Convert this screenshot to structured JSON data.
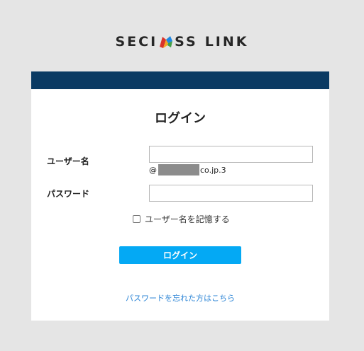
{
  "logo": {
    "left": "SECI",
    "right": "SS",
    "link": "LINK"
  },
  "login": {
    "title": "ログイン",
    "username_label": "ユーザー名",
    "username_value": "",
    "domain_prefix": "@",
    "domain_suffix": "co.jp.3",
    "password_label": "パスワード",
    "password_value": "",
    "remember_label": "ユーザー名を記憶する",
    "remember_checked": false,
    "submit_label": "ログイン",
    "forgot_link": "パスワードを忘れた方はこちら"
  },
  "colors": {
    "header_bar": "#0a3a63",
    "button": "#04a9f4",
    "link": "#2e86d6",
    "background": "#e5e5e5"
  }
}
